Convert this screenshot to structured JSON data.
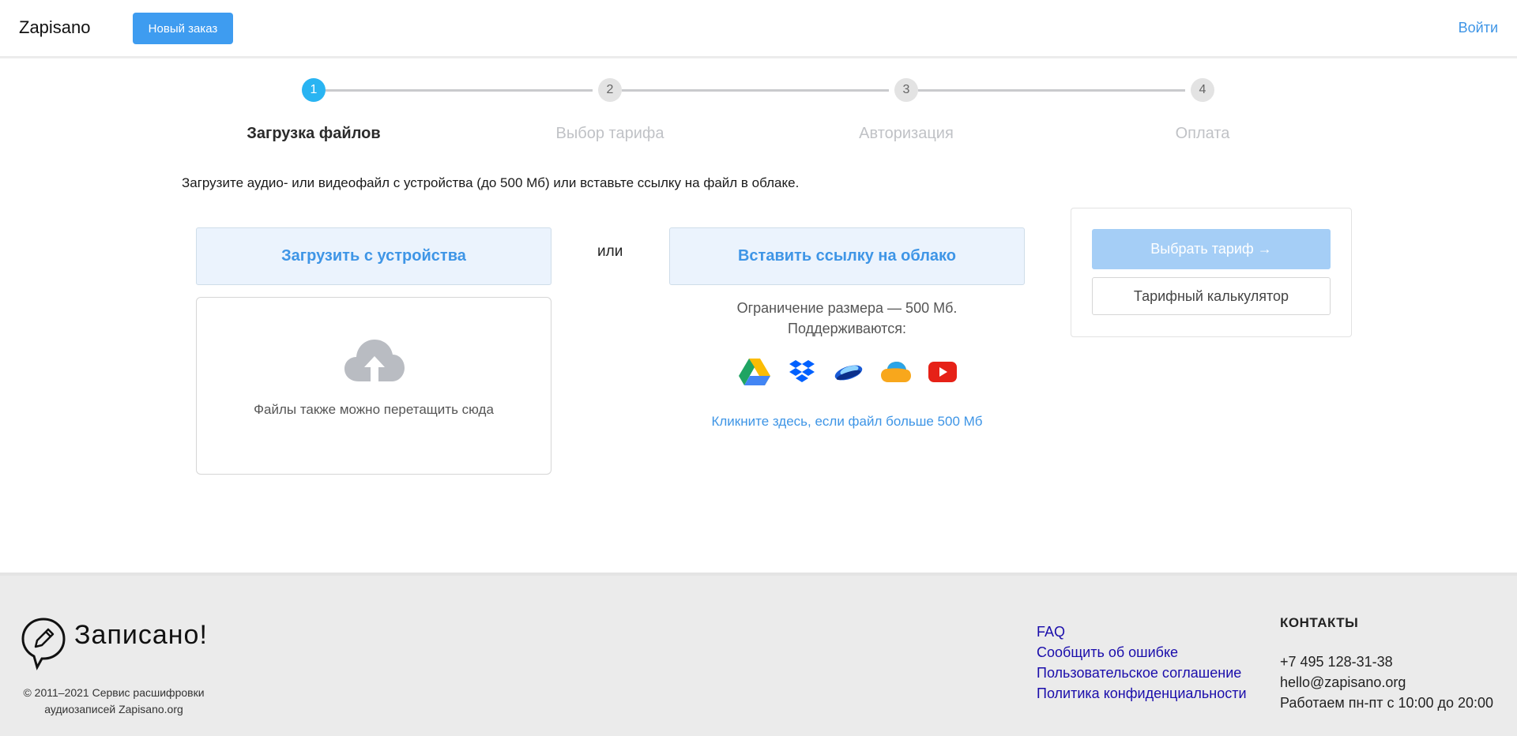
{
  "header": {
    "brand": "Zapisano",
    "new_order_label": "Новый заказ",
    "login_label": "Войти"
  },
  "stepper": {
    "steps": [
      {
        "number": "1",
        "label": "Загрузка файлов",
        "active": true
      },
      {
        "number": "2",
        "label": "Выбор тарифа",
        "active": false
      },
      {
        "number": "3",
        "label": "Авторизация",
        "active": false
      },
      {
        "number": "4",
        "label": "Оплата",
        "active": false
      }
    ]
  },
  "main": {
    "intro": "Загрузите аудио- или видеофайл с устройства (до 500 Мб) или вставьте ссылку на файл в облаке.",
    "upload_button": "Загрузить с устройства",
    "drop_text": "Файлы также можно перетащить сюда",
    "or_label": "или",
    "cloud_button": "Вставить ссылку на облако",
    "limit_line1": "Ограничение размера — 500 Мб.",
    "limit_line2": "Поддерживаются:",
    "services": [
      "google-drive-icon",
      "dropbox-icon",
      "yandex-disk-icon",
      "mail-cloud-icon",
      "youtube-icon"
    ],
    "big_file_link": "Кликните здесь, если файл больше 500 Мб"
  },
  "tariff": {
    "choose_label": "Выбрать тариф →",
    "calc_label": "Тарифный калькулятор"
  },
  "footer": {
    "logo_text": "Записано!",
    "copyright_line1": "© 2011–2021 Сервис расшифровки",
    "copyright_line2": "аудиозаписей Zapisano.org",
    "links": [
      "FAQ",
      "Сообщить об ошибке",
      "Пользовательское соглашение",
      "Политика конфиденциальности"
    ],
    "contacts_title": "КОНТАКТЫ",
    "phone": "+7 495 128-31-38",
    "email": "hello@zapisano.org",
    "hours": "Работаем пн-пт с 10:00 до 20:00"
  },
  "colors": {
    "accent": "#3e9cf0",
    "step_active": "#29b4f2",
    "link": "#3e95e6",
    "footer_link": "#1a0dab"
  }
}
